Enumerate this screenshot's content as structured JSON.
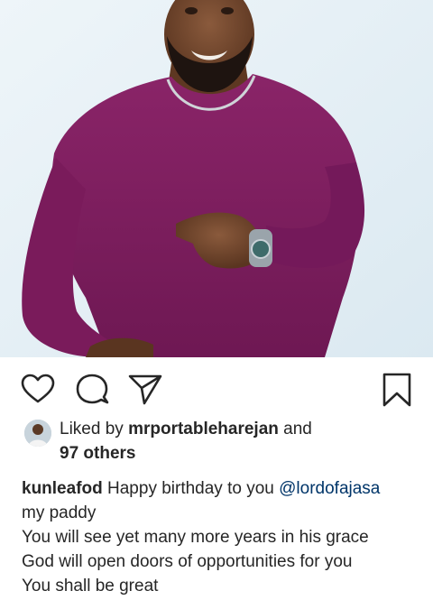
{
  "post": {
    "image_description_icon": "person-photo",
    "actions": {
      "like_icon": "heart-outline-icon",
      "comment_icon": "speech-bubble-icon",
      "share_icon": "paper-plane-icon",
      "save_icon": "bookmark-icon"
    },
    "likes": {
      "prefix": "Liked by",
      "user": "mrportableharejan",
      "conjunction": "and",
      "others": "97 others"
    },
    "caption": {
      "username": "kunleafod",
      "text_before_mention": "Happy birthday to you",
      "mention": "@lordofajasa",
      "lines": [
        "my paddy",
        "You will see yet many more years in his grace",
        "God will open doors of opportunities for you",
        "You shall be great"
      ]
    }
  },
  "colors": {
    "text": "#262626",
    "mention": "#003569",
    "shirt": "#7e1d5f",
    "background_photo": "#e3eef4"
  }
}
